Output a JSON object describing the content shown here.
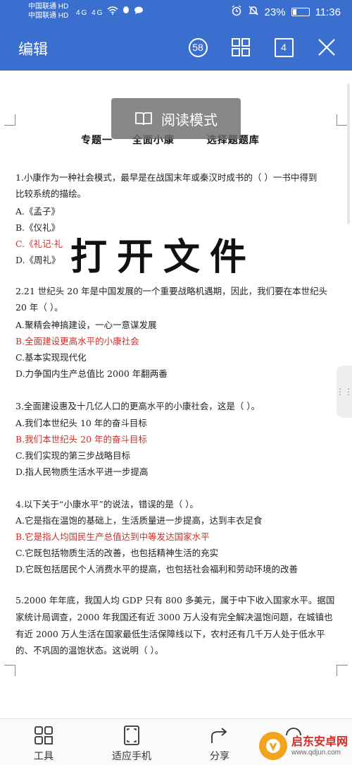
{
  "status_bar": {
    "carrier1": "中国联通 HD",
    "carrier2": "中国联通 HD",
    "signal": "4G 4G",
    "battery_percent": "23%",
    "battery_level": 0.23,
    "time": "11:36"
  },
  "toolbar": {
    "title": "编辑",
    "page_count_badge": "58",
    "tab_count": "4"
  },
  "doc": {
    "reading_mode": "阅读模式",
    "overlay": "打开文件",
    "title": [
      "专题一",
      "全面小康",
      "选择题题库"
    ],
    "lines": [
      {
        "text": "1.小康作为一种社会模式，最早是在战国末年或秦汉时成书的（ ）一书中得到",
        "red": false
      },
      {
        "text": "比较系统的描绘。",
        "red": false
      },
      {
        "text": "A.《孟子》",
        "red": false
      },
      {
        "text": "B.《仪礼》",
        "red": false
      },
      {
        "text": "C.《礼记·礼",
        "red": true
      },
      {
        "text": "D.《周礼》",
        "red": false
      },
      {
        "text": "2.21 世纪头 20 年是中国发展的一个重要战略机遇期，因此，我们要在本世纪头",
        "red": false
      },
      {
        "text": "20 年（ ）。",
        "red": false
      },
      {
        "text": "A.聚精会神搞建设，一心一意谋发展",
        "red": false
      },
      {
        "text": "B.全面建设更高水平的小康社会",
        "red": true
      },
      {
        "text": "C.基本实现现代化",
        "red": false
      },
      {
        "text": "D.力争国内生产总值比 2000 年翻两番",
        "red": false
      },
      {
        "text": "3.全面建设惠及十几亿人口的更高水平的小康社会，这是（ ）。",
        "red": false
      },
      {
        "text": "A.我们本世纪头 10 年的奋斗目标",
        "red": false
      },
      {
        "text": "B.我们本世纪头 20 年的奋斗目标",
        "red": true
      },
      {
        "text": "C.我们实现的第三步战略目标",
        "red": false
      },
      {
        "text": "D.指人民物质生活水平进一步提高",
        "red": false
      },
      {
        "text": "4.以下关于“小康水平”的说法，错误的是（ ）。",
        "red": false
      },
      {
        "text": "A.它是指在温饱的基础上，生活质量进一步提高，达到丰衣足食",
        "red": false
      },
      {
        "text": "B.它是指人均国民生产总值达到中等发达国家水平",
        "red": true
      },
      {
        "text": "C.它既包括物质生活的改善，也包括精神生活的充实",
        "red": false
      },
      {
        "text": "D.它既包括居民个人消费水平的提高，也包括社会福利和劳动环境的改善",
        "red": false
      },
      {
        "text": "5.2000 年年底，我国人均 GDP 只有 800 多美元，属于中下收入国家水平。据国",
        "red": false
      },
      {
        "text": "家统计局调查，2000 年我国还有近 3000 万人没有完全解决温饱问题，在城镇也",
        "red": false
      },
      {
        "text": "有近 2000 万人生活在国家最低生活保障线以下，农村还有几千万人处于低水平",
        "red": false
      },
      {
        "text": "的、不巩固的温饱状态。这说明（ ）。",
        "red": false
      }
    ]
  },
  "bottom_bar": {
    "tools": "工具",
    "fit_phone": "适应手机",
    "share": "分享"
  },
  "watermark": {
    "name": "启东安卓网",
    "url": "www.qdjun.com"
  }
}
